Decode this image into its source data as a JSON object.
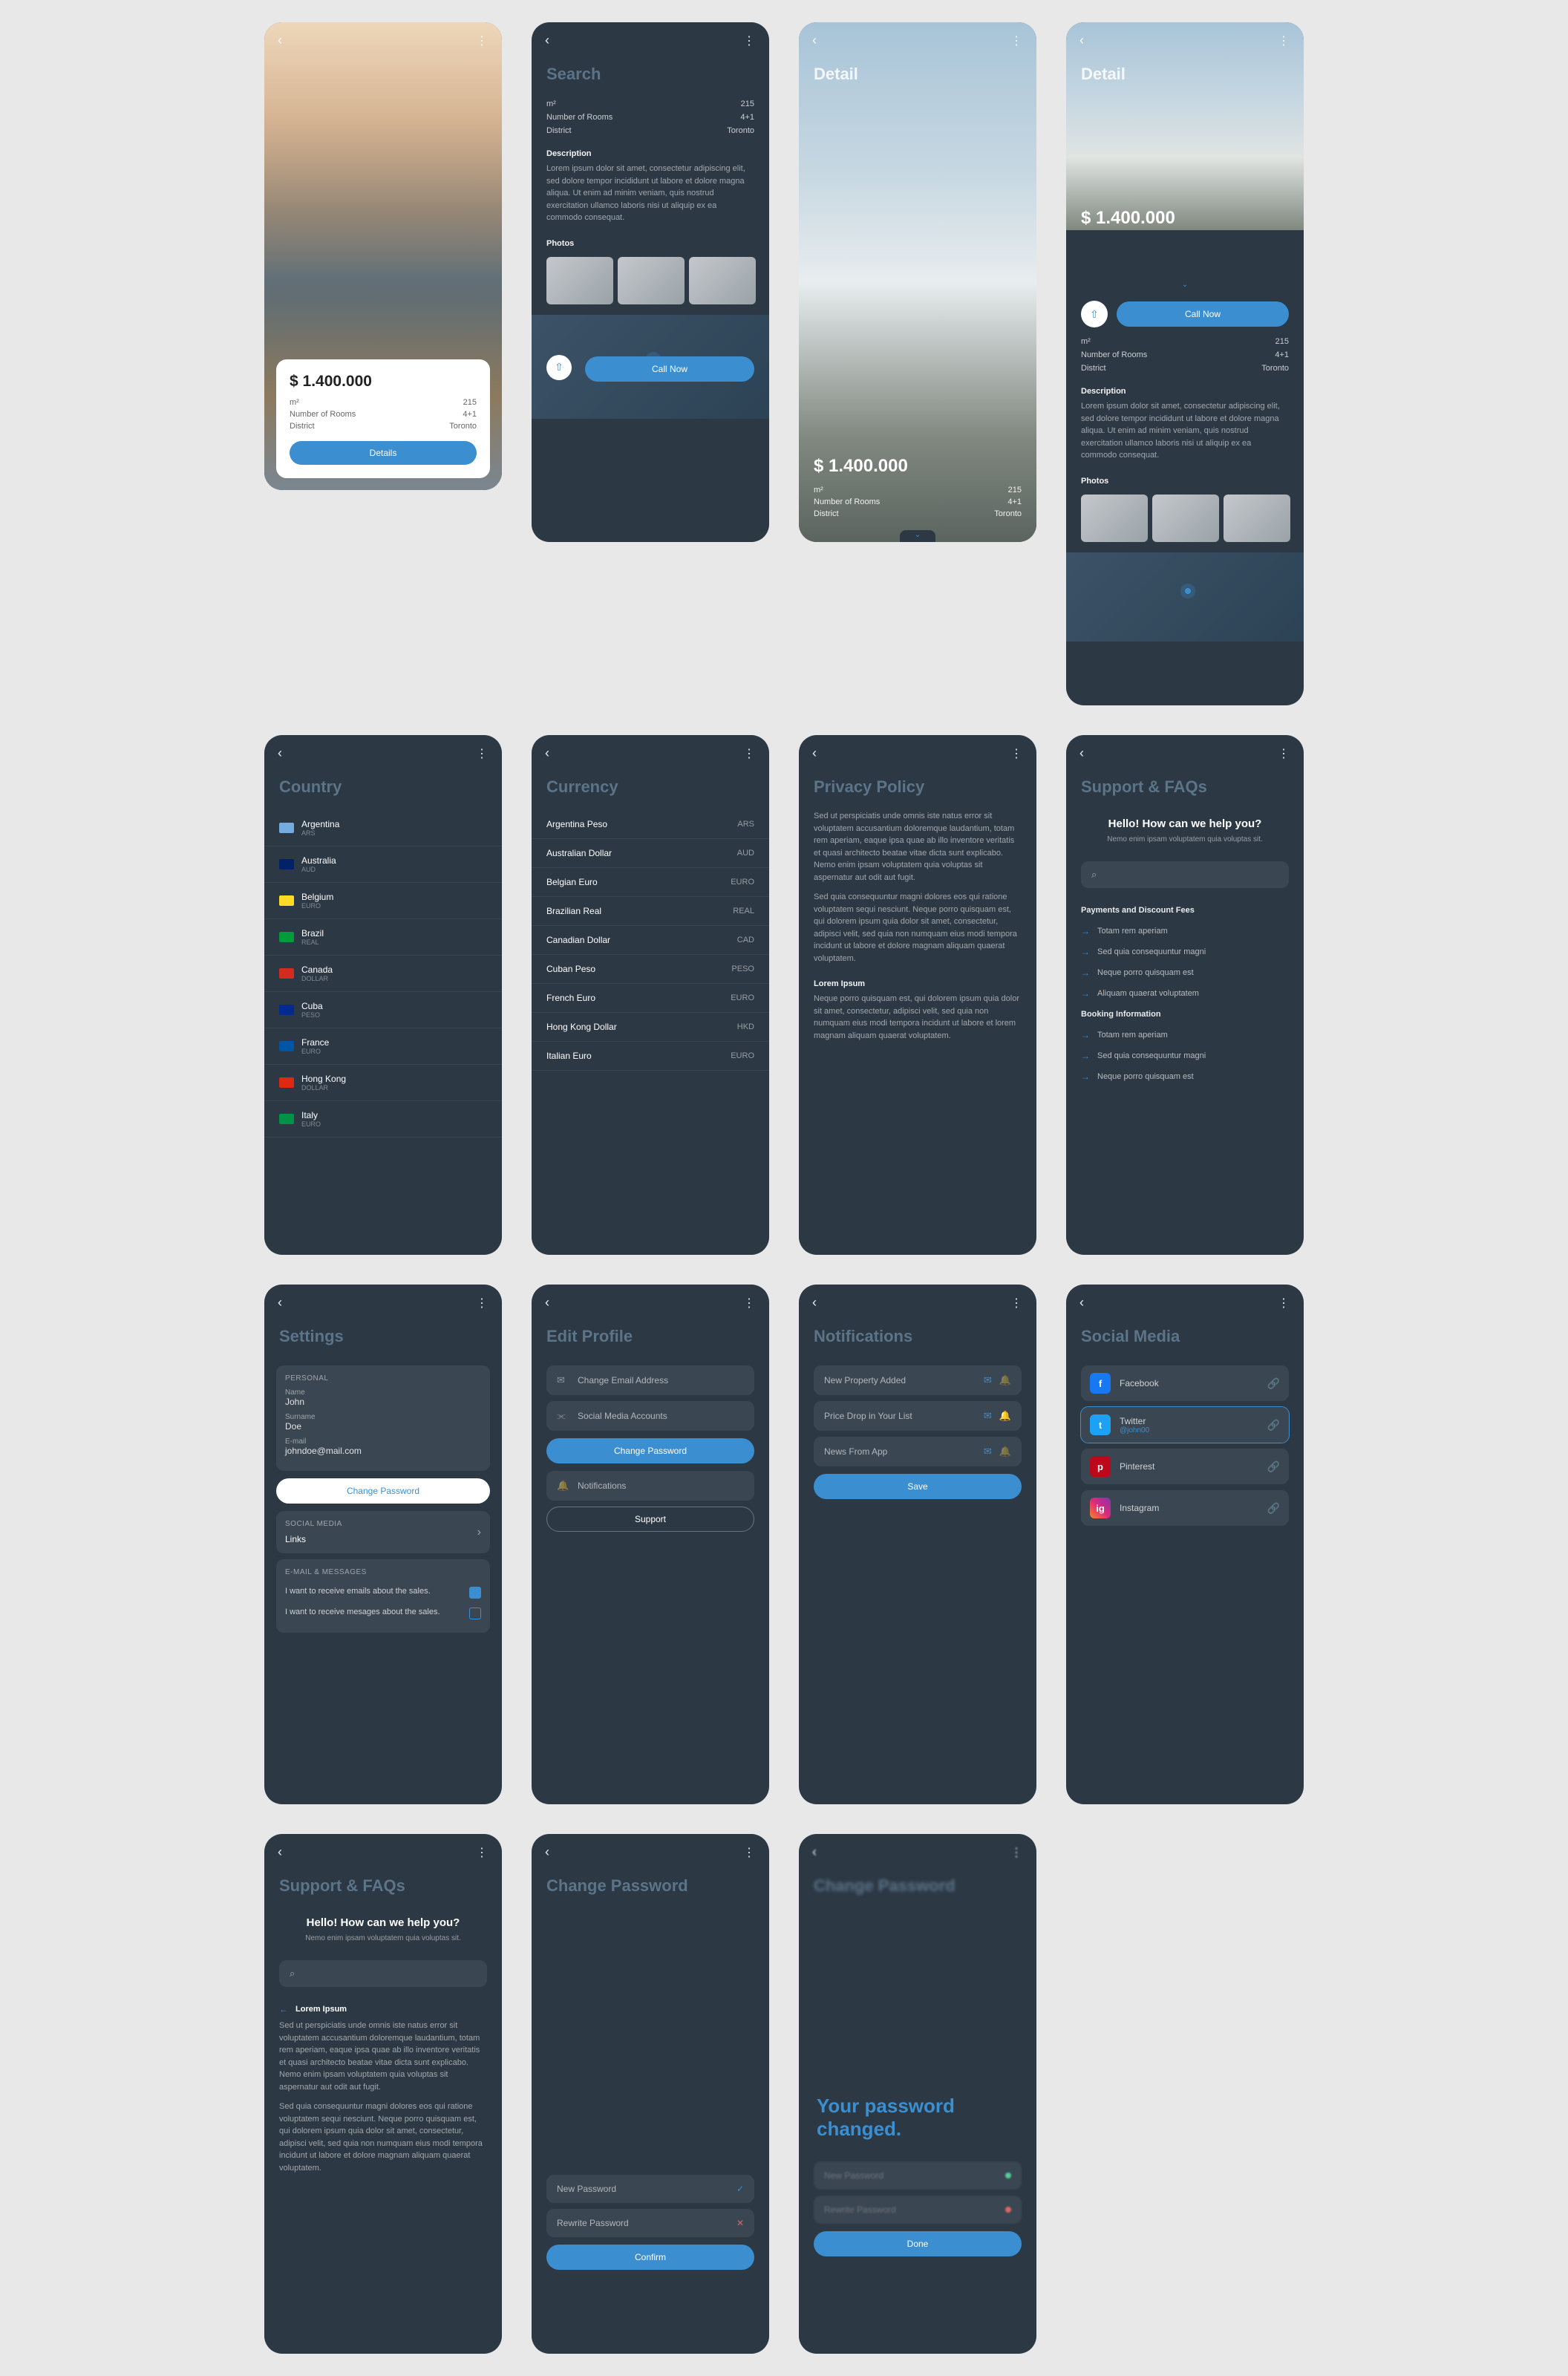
{
  "common": {
    "price": "$ 1.400.000",
    "kv": {
      "sqm_label": "m²",
      "sqm": "215",
      "rooms_label": "Number of Rooms",
      "rooms": "4+1",
      "district_label": "District",
      "district": "Toronto"
    },
    "desc_label": "Description",
    "photos_label": "Photos",
    "call_now": "Call Now",
    "details": "Details",
    "lorem_short": "Lorem ipsum dolor sit amet, consectetur adipiscing elit, sed dolore tempor incididunt ut labore et dolore magna aliqua. Ut enim ad minim veniam, quis nostrud exercitation ullamco laboris nisi ut aliquip ex ea commodo consequat."
  },
  "search": {
    "title": "Search"
  },
  "detail": {
    "title": "Detail"
  },
  "country": {
    "title": "Country",
    "items": [
      {
        "name": "Argentina",
        "sub": "ARS",
        "flag": "#74acdf"
      },
      {
        "name": "Australia",
        "sub": "AUD",
        "flag": "#012169"
      },
      {
        "name": "Belgium",
        "sub": "EURO",
        "flag": "#fdda24"
      },
      {
        "name": "Brazil",
        "sub": "REAL",
        "flag": "#009b3a"
      },
      {
        "name": "Canada",
        "sub": "DOLLAR",
        "flag": "#d52b1e"
      },
      {
        "name": "Cuba",
        "sub": "PESO",
        "flag": "#002a8f"
      },
      {
        "name": "France",
        "sub": "EURO",
        "flag": "#0055a4"
      },
      {
        "name": "Hong Kong",
        "sub": "DOLLAR",
        "flag": "#de2910"
      },
      {
        "name": "Italy",
        "sub": "EURO",
        "flag": "#009246"
      }
    ]
  },
  "currency": {
    "title": "Currency",
    "items": [
      {
        "name": "Argentina Peso",
        "code": "ARS"
      },
      {
        "name": "Australian Dollar",
        "code": "AUD"
      },
      {
        "name": "Belgian Euro",
        "code": "EURO"
      },
      {
        "name": "Brazilian Real",
        "code": "REAL"
      },
      {
        "name": "Canadian Dollar",
        "code": "CAD"
      },
      {
        "name": "Cuban Peso",
        "code": "PESO"
      },
      {
        "name": "French Euro",
        "code": "EURO"
      },
      {
        "name": "Hong Kong Dollar",
        "code": "HKD"
      },
      {
        "name": "Italian Euro",
        "code": "EURO"
      }
    ]
  },
  "privacy": {
    "title": "Privacy Policy",
    "p1": "Sed ut perspiciatis unde omnis iste natus error sit voluptatem accusantium doloremque laudantium, totam rem aperiam, eaque ipsa quae ab illo inventore veritatis et quasi architecto beatae vitae dicta sunt explicabo. Nemo enim ipsam voluptatem quia voluptas sit aspernatur aut odit aut fugit.",
    "p2": "Sed quia consequuntur magni dolores eos qui ratione voluptatem sequi nesciunt. Neque porro quisquam est, qui dolorem ipsum quia dolor sit amet, consectetur, adipisci velit, sed quia non numquam eius modi tempora incidunt ut labore et dolore magnam aliquam quaerat voluptatem.",
    "h3": "Lorem Ipsum",
    "p3": "Neque porro quisquam est, qui dolorem ipsum quia dolor sit amet, consectetur, adipisci velit, sed quia non numquam eius modi tempora incidunt ut labore et lorem magnam aliquam quaerat voluptatem."
  },
  "settings": {
    "title": "Settings",
    "personal": "PERSONAL",
    "name_l": "Name",
    "name": "John",
    "surname_l": "Surname",
    "surname": "Doe",
    "email_l": "E-mail",
    "email": "johndoe@mail.com",
    "change_pw": "Change Password",
    "social": "SOCIAL MEDIA",
    "links": "Links",
    "msgs": "E-MAIL & MESSAGES",
    "opt1": "I want to receive emails about the sales.",
    "opt2": "I want to receive mesages about the sales."
  },
  "edit_profile": {
    "title": "Edit Profile",
    "email": "Change Email Address",
    "social": "Social Media Accounts",
    "change_pw": "Change Password",
    "notif": "Notifications",
    "support": "Support"
  },
  "notifications": {
    "title": "Notifications",
    "items": [
      "New Property Added",
      "Price Drop in Your List",
      "News From App"
    ],
    "save": "Save"
  },
  "support": {
    "title": "Support & FAQs",
    "hero_h": "Hello! How can we help you?",
    "hero_s": "Nemo enim ipsam voluptatem quia voluptas sit.",
    "cat1": "Payments and Discount Fees",
    "cat2": "Booking Information",
    "items1": [
      "Totam rem aperiam",
      "Sed quia consequuntur magni",
      "Neque porro quisquam est",
      "Aliquam quaerat voluptatem"
    ],
    "items2": [
      "Totam rem aperiam",
      "Sed quia consequuntur magni",
      "Neque porro quisquam est"
    ]
  },
  "support2": {
    "back": "Lorem Ipsum",
    "p1": "Sed ut perspiciatis unde omnis iste natus error sit voluptatem accusantium doloremque laudantium, totam rem aperiam, eaque ipsa quae ab illo inventore veritatis et quasi architecto beatae vitae dicta sunt explicabo. Nemo enim ipsam voluptatem quia voluptas sit aspernatur aut odit aut fugit.",
    "p2": "Sed quia consequuntur magni dolores eos qui ratione voluptatem sequi nesciunt. Neque porro quisquam est, qui dolorem ipsum quia dolor sit amet, consectetur, adipisci velit, sed quia non numquam eius modi tempora incidunt ut labore et dolore magnam aliquam quaerat voluptatem."
  },
  "social": {
    "title": "Social Media",
    "items": [
      {
        "name": "Facebook",
        "bg": "#1877f2"
      },
      {
        "name": "Twitter",
        "sub": "@john00",
        "bg": "#1da1f2"
      },
      {
        "name": "Pinterest",
        "bg": "#bd081c"
      },
      {
        "name": "Instagram",
        "bg": "linear-gradient(45deg,#f58529,#dd2a7b,#8134af)"
      }
    ]
  },
  "change_pw": {
    "title": "Change Password",
    "new": "New Password",
    "rewrite": "Rewrite Password",
    "confirm": "Confirm"
  },
  "pw_done": {
    "title_blur": "Change Password",
    "msg": "Your password changed.",
    "done": "Done",
    "f1": "New Password",
    "f2": "Rewrite Password"
  }
}
